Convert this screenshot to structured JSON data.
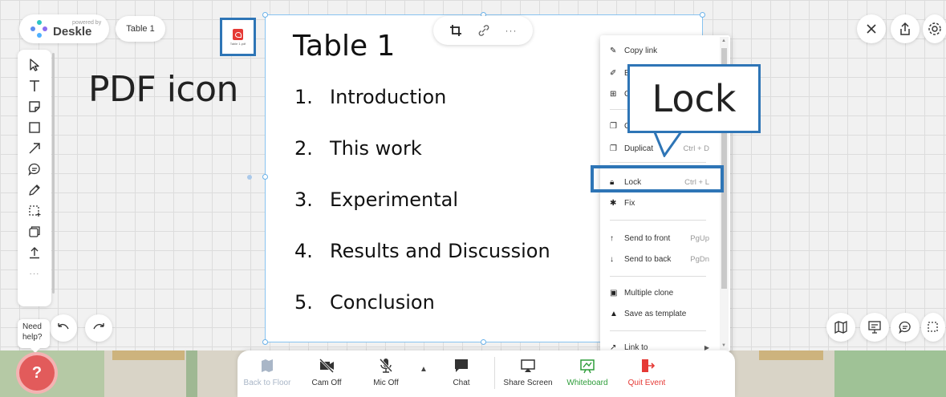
{
  "brand": {
    "powered_by": "powered by",
    "name": "Deskle"
  },
  "board_chip": {
    "label": "Table 1"
  },
  "pdf_icon": {
    "caption": "Table 1.pdf",
    "annotation": "PDF icon"
  },
  "document": {
    "title": "Table 1",
    "items": [
      {
        "num": "1.",
        "text": "Introduction"
      },
      {
        "num": "2.",
        "text": "This work"
      },
      {
        "num": "3.",
        "text": "Experimental"
      },
      {
        "num": "4.",
        "text": "Results and Discussion"
      },
      {
        "num": "5.",
        "text": "Conclusion"
      }
    ]
  },
  "float_toolbar": {
    "more": "···"
  },
  "context_menu": {
    "items": [
      {
        "icon": "link-edit-icon",
        "label": "Copy link",
        "shortcut": ""
      },
      {
        "icon": "pencil-icon",
        "label": "E",
        "shortcut": ""
      },
      {
        "icon": "table-icon",
        "label": "C",
        "shortcut": ""
      },
      {
        "icon": "copy-icon",
        "label": "C",
        "shortcut": ""
      },
      {
        "icon": "duplicate-icon",
        "label": "Duplicat",
        "shortcut": "Ctrl + D"
      },
      {
        "icon": "lock-icon",
        "label": "Lock",
        "shortcut": "Ctrl + L"
      },
      {
        "icon": "pin-icon",
        "label": "Fix",
        "shortcut": ""
      },
      {
        "icon": "arrow-up-icon",
        "label": "Send to front",
        "shortcut": "PgUp"
      },
      {
        "icon": "arrow-down-icon",
        "label": "Send to back",
        "shortcut": "PgDn"
      },
      {
        "icon": "multi-clone-icon",
        "label": "Multiple clone",
        "shortcut": ""
      },
      {
        "icon": "template-icon",
        "label": "Save as template",
        "shortcut": ""
      },
      {
        "icon": "link-icon",
        "label": "Link to",
        "shortcut": ""
      }
    ]
  },
  "lock_annotation": "Lock",
  "help": {
    "tooltip": "Need help?"
  },
  "bottom_bar": {
    "back_to_floor": "Back to Floor",
    "cam_off": "Cam Off",
    "mic_off": "Mic Off",
    "chat": "Chat",
    "share_screen": "Share Screen",
    "whiteboard": "Whiteboard",
    "quit_event": "Quit Event"
  },
  "colors": {
    "annotation_blue": "#2e75b6",
    "whiteboard_green": "#2e9d3a",
    "quit_red": "#e53935",
    "help_red": "#e25b5b"
  }
}
